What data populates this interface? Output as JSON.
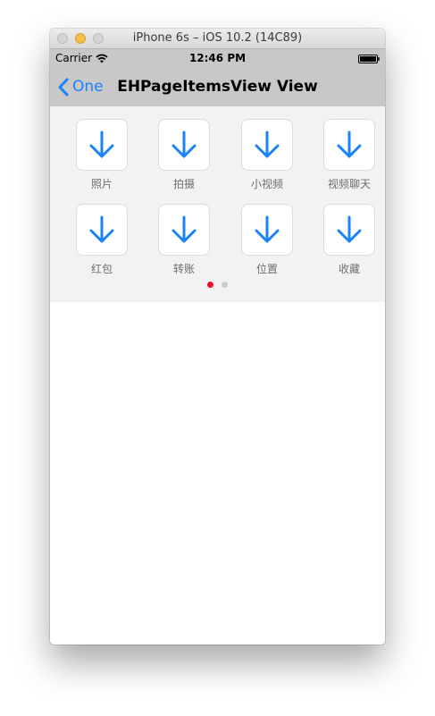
{
  "window": {
    "title": "iPhone 6s – iOS 10.2 (14C89)"
  },
  "status_bar": {
    "carrier": "Carrier",
    "time": "12:46 PM"
  },
  "nav_bar": {
    "back_label": "One",
    "title": "EHPageItemsView View"
  },
  "page_items": {
    "items": [
      {
        "label": "照片",
        "icon": "arrow-down-icon"
      },
      {
        "label": "拍摄",
        "icon": "arrow-down-icon"
      },
      {
        "label": "小视频",
        "icon": "arrow-down-icon"
      },
      {
        "label": "视频聊天",
        "icon": "arrow-down-icon"
      },
      {
        "label": "红包",
        "icon": "arrow-down-icon"
      },
      {
        "label": "转账",
        "icon": "arrow-down-icon"
      },
      {
        "label": "位置",
        "icon": "arrow-down-icon"
      },
      {
        "label": "收藏",
        "icon": "arrow-down-icon"
      }
    ],
    "page_count": 2,
    "current_page": 1
  },
  "colors": {
    "accent": "#1a82fb",
    "dot_active": "#e8102a",
    "dot_inactive": "#cccccc",
    "bar_background": "#c8c8c8",
    "page_background": "#f2f2f2"
  }
}
